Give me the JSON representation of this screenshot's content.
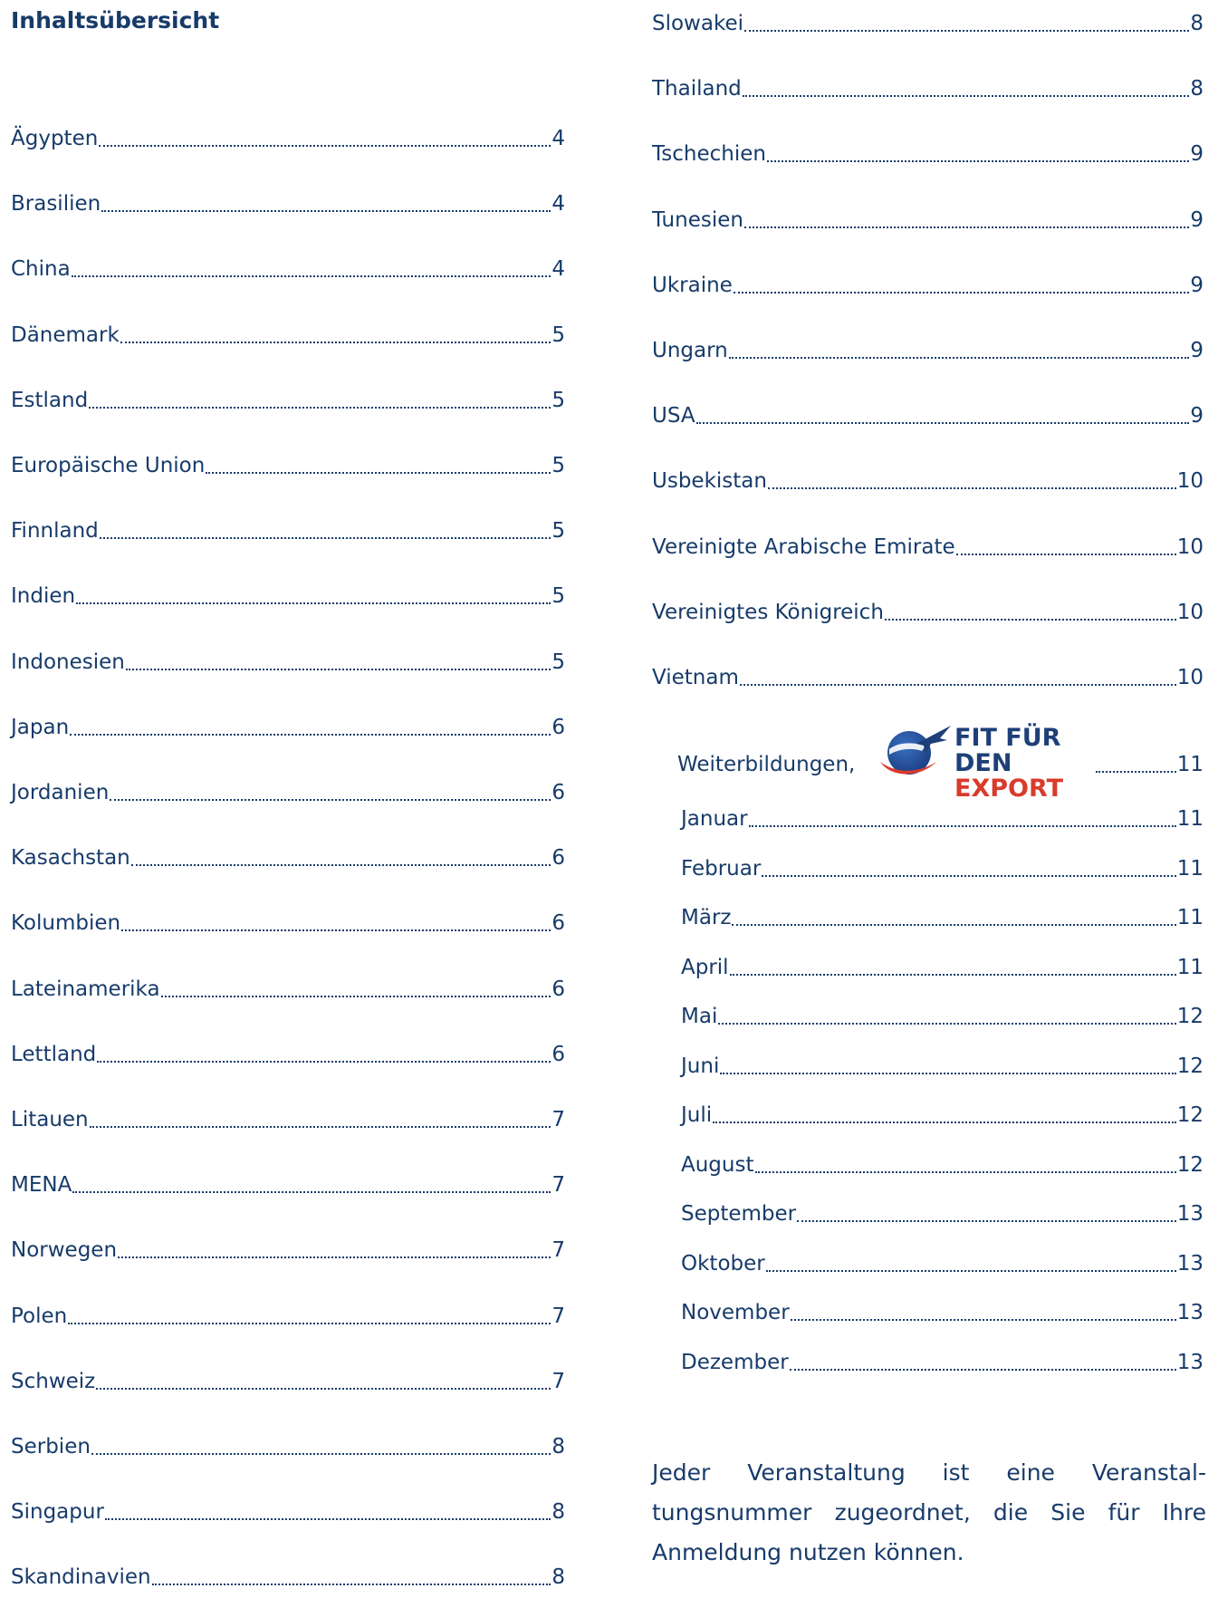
{
  "title": "Inhaltsübersicht",
  "left_entries": [
    {
      "label": "Ägypten",
      "page": "4"
    },
    {
      "label": "Brasilien",
      "page": "4"
    },
    {
      "label": "China",
      "page": "4"
    },
    {
      "label": "Dänemark",
      "page": "5"
    },
    {
      "label": "Estland",
      "page": "5"
    },
    {
      "label": "Europäische Union",
      "page": "5"
    },
    {
      "label": "Finnland",
      "page": "5"
    },
    {
      "label": "Indien",
      "page": "5"
    },
    {
      "label": "Indonesien",
      "page": "5"
    },
    {
      "label": "Japan",
      "page": "6"
    },
    {
      "label": "Jordanien",
      "page": "6"
    },
    {
      "label": "Kasachstan",
      "page": "6"
    },
    {
      "label": "Kolumbien",
      "page": "6"
    },
    {
      "label": "Lateinamerika",
      "page": "6"
    },
    {
      "label": "Lettland",
      "page": "6"
    },
    {
      "label": "Litauen",
      "page": "7"
    },
    {
      "label": "MENA",
      "page": "7"
    },
    {
      "label": "Norwegen",
      "page": "7"
    },
    {
      "label": "Polen",
      "page": "7"
    },
    {
      "label": "Schweiz",
      "page": "7"
    },
    {
      "label": "Serbien",
      "page": "8"
    },
    {
      "label": "Singapur",
      "page": "8"
    },
    {
      "label": "Skandinavien",
      "page": "8"
    }
  ],
  "right_entries": [
    {
      "label": "Slowakei",
      "page": "8"
    },
    {
      "label": "Thailand",
      "page": "8"
    },
    {
      "label": "Tschechien",
      "page": "9"
    },
    {
      "label": "Tunesien",
      "page": "9"
    },
    {
      "label": "Ukraine",
      "page": "9"
    },
    {
      "label": "Ungarn",
      "page": "9"
    },
    {
      "label": "USA",
      "page": "9"
    },
    {
      "label": "Usbekistan",
      "page": "10"
    },
    {
      "label": "Vereinigte Arabische Emirate",
      "page": "10"
    },
    {
      "label": "Vereinigtes Königreich",
      "page": "10"
    },
    {
      "label": "Vietnam",
      "page": "10"
    }
  ],
  "training": {
    "label": "Weiterbildungen,",
    "page": "11",
    "logo_line1": "FIT FÜR DEN",
    "logo_line2": "EXPORT",
    "logo_icon": "globe-airplane-logo-icon",
    "colors": {
      "navy": "#1e3f78",
      "red": "#d93b2b"
    }
  },
  "months": [
    {
      "label": "Januar",
      "page": "11"
    },
    {
      "label": "Februar",
      "page": "11"
    },
    {
      "label": "März",
      "page": "11"
    },
    {
      "label": "April",
      "page": "11"
    },
    {
      "label": "Mai",
      "page": "12"
    },
    {
      "label": "Juni",
      "page": "12"
    },
    {
      "label": "Juli",
      "page": "12"
    },
    {
      "label": "August",
      "page": "12"
    },
    {
      "label": "September",
      "page": "13"
    },
    {
      "label": "Oktober",
      "page": "13"
    },
    {
      "label": "November",
      "page": "13"
    },
    {
      "label": "Dezember",
      "page": "13"
    }
  ],
  "note": "Jeder Veranstaltung ist eine Veranstal-tungsnummer zugeordnet, die Sie für Ihre Anmeldung nutzen können.",
  "colors": {
    "text": "#173b6a"
  }
}
